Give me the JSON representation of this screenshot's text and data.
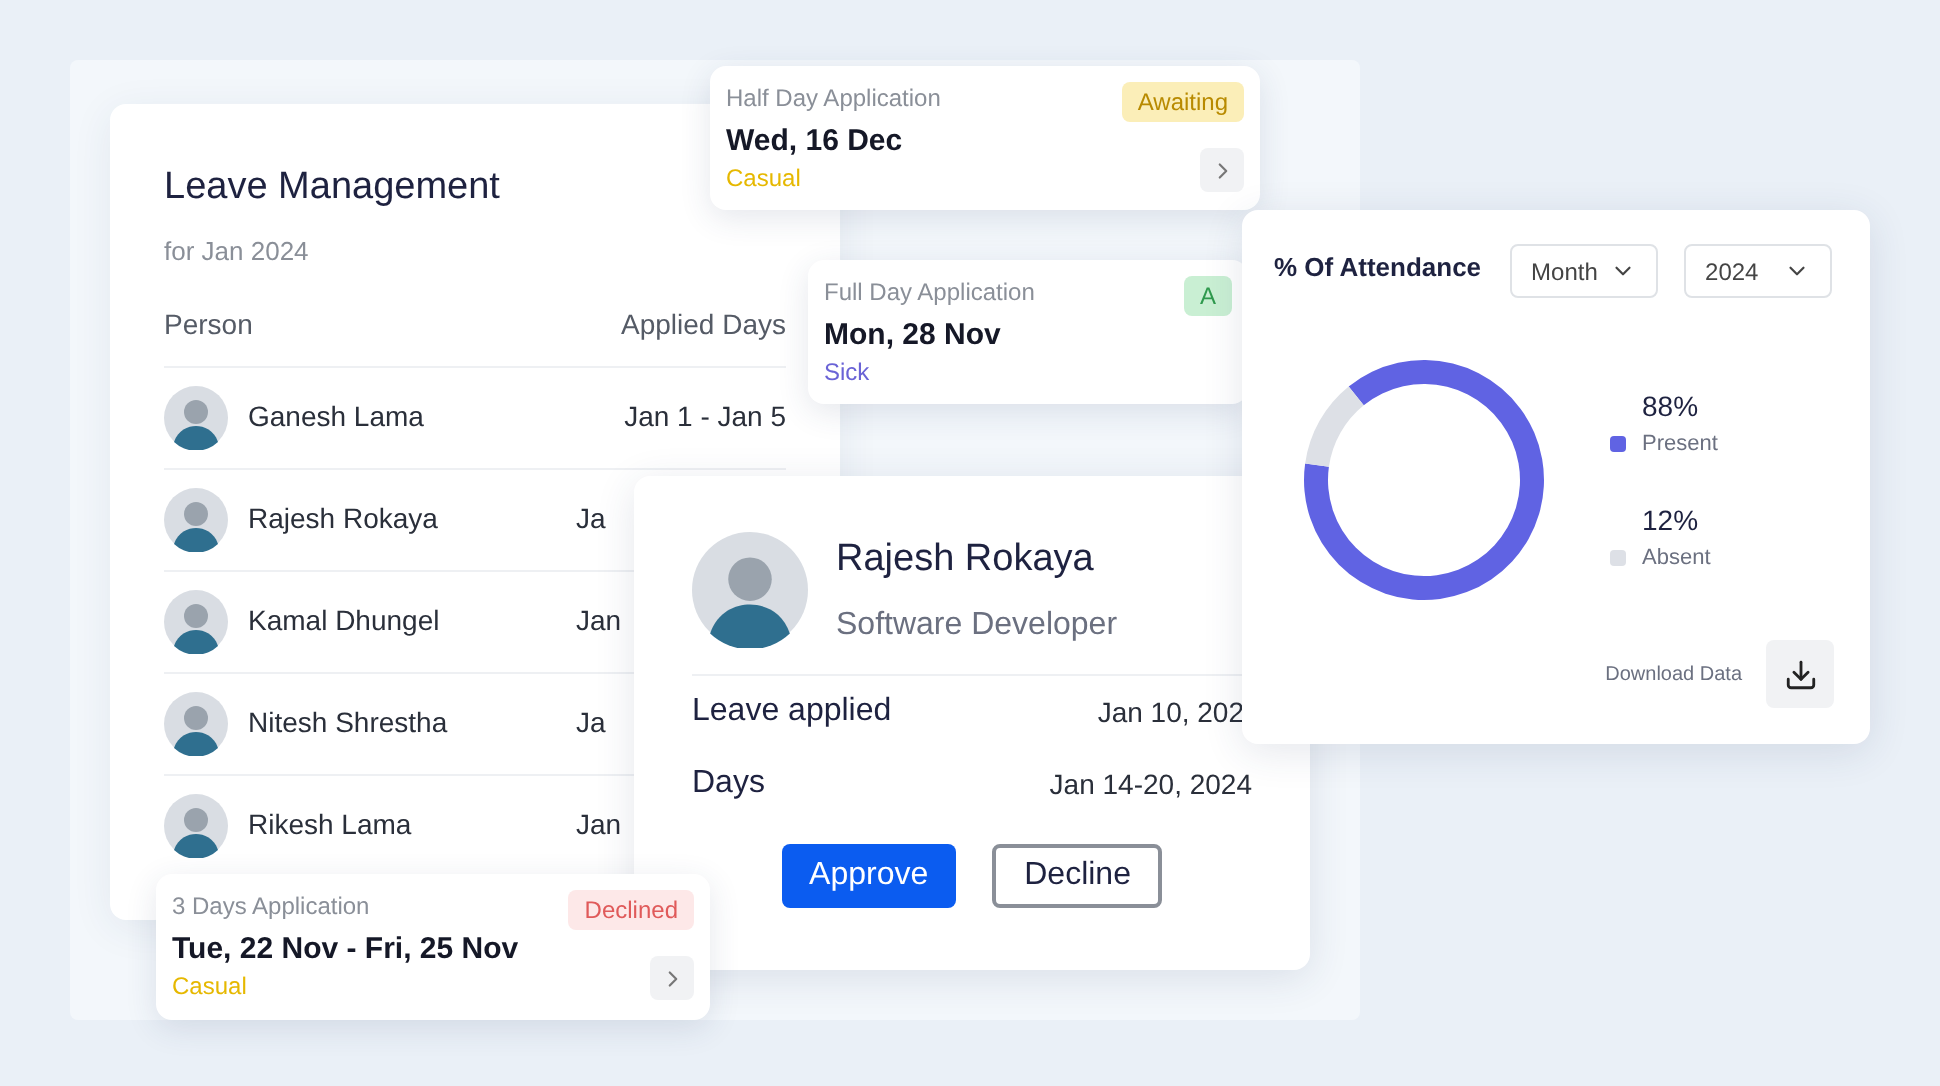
{
  "leave_management": {
    "title": "Leave Management",
    "subtitle": "for Jan 2024",
    "columns": [
      "Person",
      "Applied Days"
    ],
    "rows": [
      {
        "name": "Ganesh Lama",
        "applied_days": "Jan 1 - Jan 5"
      },
      {
        "name": "Rajesh Rokaya",
        "applied_days": "Ja"
      },
      {
        "name": "Kamal Dhungel",
        "applied_days": "Jan"
      },
      {
        "name": "Nitesh Shrestha",
        "applied_days": "Ja"
      },
      {
        "name": "Rikesh Lama",
        "applied_days": "Jan"
      }
    ]
  },
  "applications": [
    {
      "type": "Half Day Application",
      "date": "Wed, 16 Dec",
      "category": "Casual",
      "color": "#e6b800",
      "status": "Awaiting",
      "kind": "awaiting"
    },
    {
      "type": "Full Day Application",
      "date": "Mon, 28 Nov",
      "category": "Sick",
      "color": "#6a63d6",
      "status": "A",
      "kind": "approved"
    },
    {
      "type": "3 Days Application",
      "date": "Tue, 22 Nov - Fri, 25 Nov",
      "category": "Casual",
      "color": "#e6b800",
      "status": "Declined",
      "kind": "declined"
    }
  ],
  "employee_detail": {
    "name": "Rajesh Rokaya",
    "role": "Software Developer",
    "fields": [
      {
        "label": "Leave applied",
        "value": "Jan 10, 202"
      },
      {
        "label": "Days",
        "value": "Jan 14-20, 2024"
      }
    ],
    "buttons": [
      {
        "label": "Approve",
        "kind": "primary"
      },
      {
        "label": "Decline",
        "kind": "outline"
      }
    ]
  },
  "attendance": {
    "title": "% Of Attendance",
    "filters": [
      {
        "value": "Month"
      },
      {
        "value": "2024"
      }
    ],
    "chart_data": {
      "type": "donut",
      "categories": [
        "Present",
        "Absent"
      ],
      "values": [
        88,
        12
      ]
    },
    "legend": [
      {
        "value": "88%",
        "color": "#6063e3"
      },
      {
        "value": "12%",
        "color": "#dde0e6"
      }
    ],
    "download_label": "Download Data"
  }
}
